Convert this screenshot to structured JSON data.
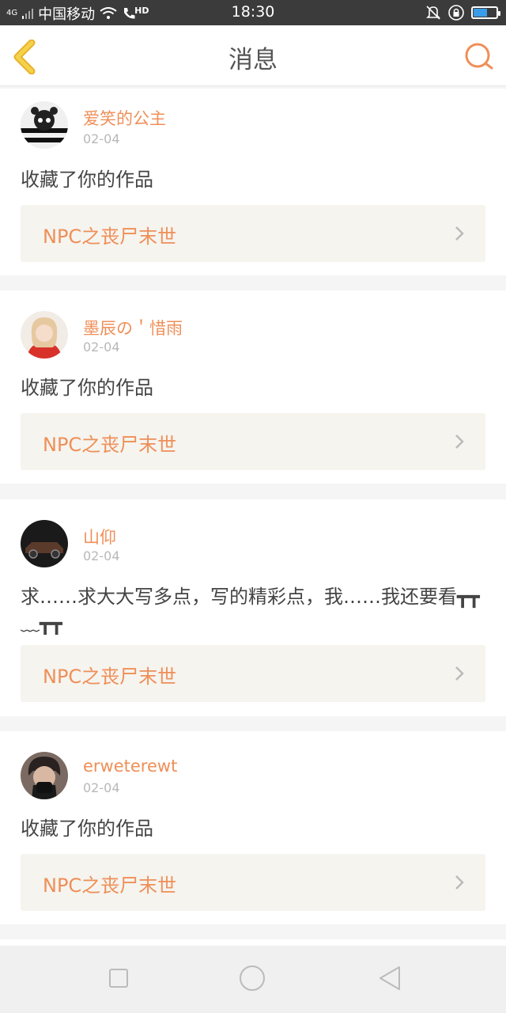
{
  "status_bar": {
    "network_type": "4G",
    "carrier": "中国移动",
    "hd_label": "HD",
    "time": "18:30",
    "battery_level": 0.55
  },
  "header": {
    "title": "消息",
    "back_icon": "chevron-left-icon",
    "search_icon": "search-icon"
  },
  "messages": [
    {
      "username": "爱笑的公主",
      "date": "02-04",
      "text": "收藏了你的作品",
      "work_title": "NPC之丧尸末世"
    },
    {
      "username": "墨辰の＇惜雨",
      "date": "02-04",
      "text": "收藏了你的作品",
      "work_title": "NPC之丧尸末世"
    },
    {
      "username": "山仰",
      "date": "02-04",
      "text": "求……求大大写多点，写的精彩点，我……我还要看┳┳﹏┳┳",
      "work_title": "NPC之丧尸末世"
    },
    {
      "username": "erweterewt",
      "date": "02-04",
      "text": "收藏了你的作品",
      "work_title": "NPC之丧尸末世"
    }
  ],
  "bottom_nav": {
    "recent_icon": "square-icon",
    "home_icon": "circle-icon",
    "back_icon": "triangle-back-icon"
  },
  "colors": {
    "accent": "#ef8f58",
    "back_arrow": "#f2c12e",
    "status_bar": "#3b3b3b",
    "work_bg": "#f5f4ef"
  }
}
